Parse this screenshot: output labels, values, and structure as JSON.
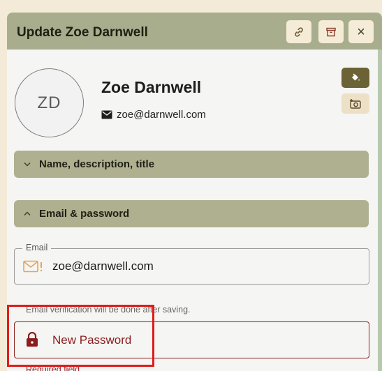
{
  "dialog": {
    "title": "Update Zoe Darnwell",
    "header_buttons": [
      {
        "icon": "link-icon"
      },
      {
        "icon": "archive-icon"
      },
      {
        "icon": "close-icon",
        "label": "×"
      }
    ]
  },
  "profile": {
    "initials": "ZD",
    "name": "Zoe Darnwell",
    "email": "zoe@darnwell.com"
  },
  "tools": [
    {
      "icon": "paint-bucket-icon",
      "color": "#6b6336"
    },
    {
      "icon": "add-photo-icon",
      "color": "#ece0c6"
    }
  ],
  "sections": {
    "name_section": {
      "label": "Name, description, title",
      "expanded": false
    },
    "email_section": {
      "label": "Email & password",
      "expanded": true
    }
  },
  "email_field": {
    "legend": "Email",
    "value": "zoe@darnwell.com",
    "helper": "Email verification will be done after saving."
  },
  "password_field": {
    "placeholder": "New Password",
    "error": "Required field"
  },
  "colors": {
    "header": "#a8ad8e",
    "section": "#aeb08f",
    "error": "#8b1d1d",
    "highlight": "#e11b1b"
  }
}
